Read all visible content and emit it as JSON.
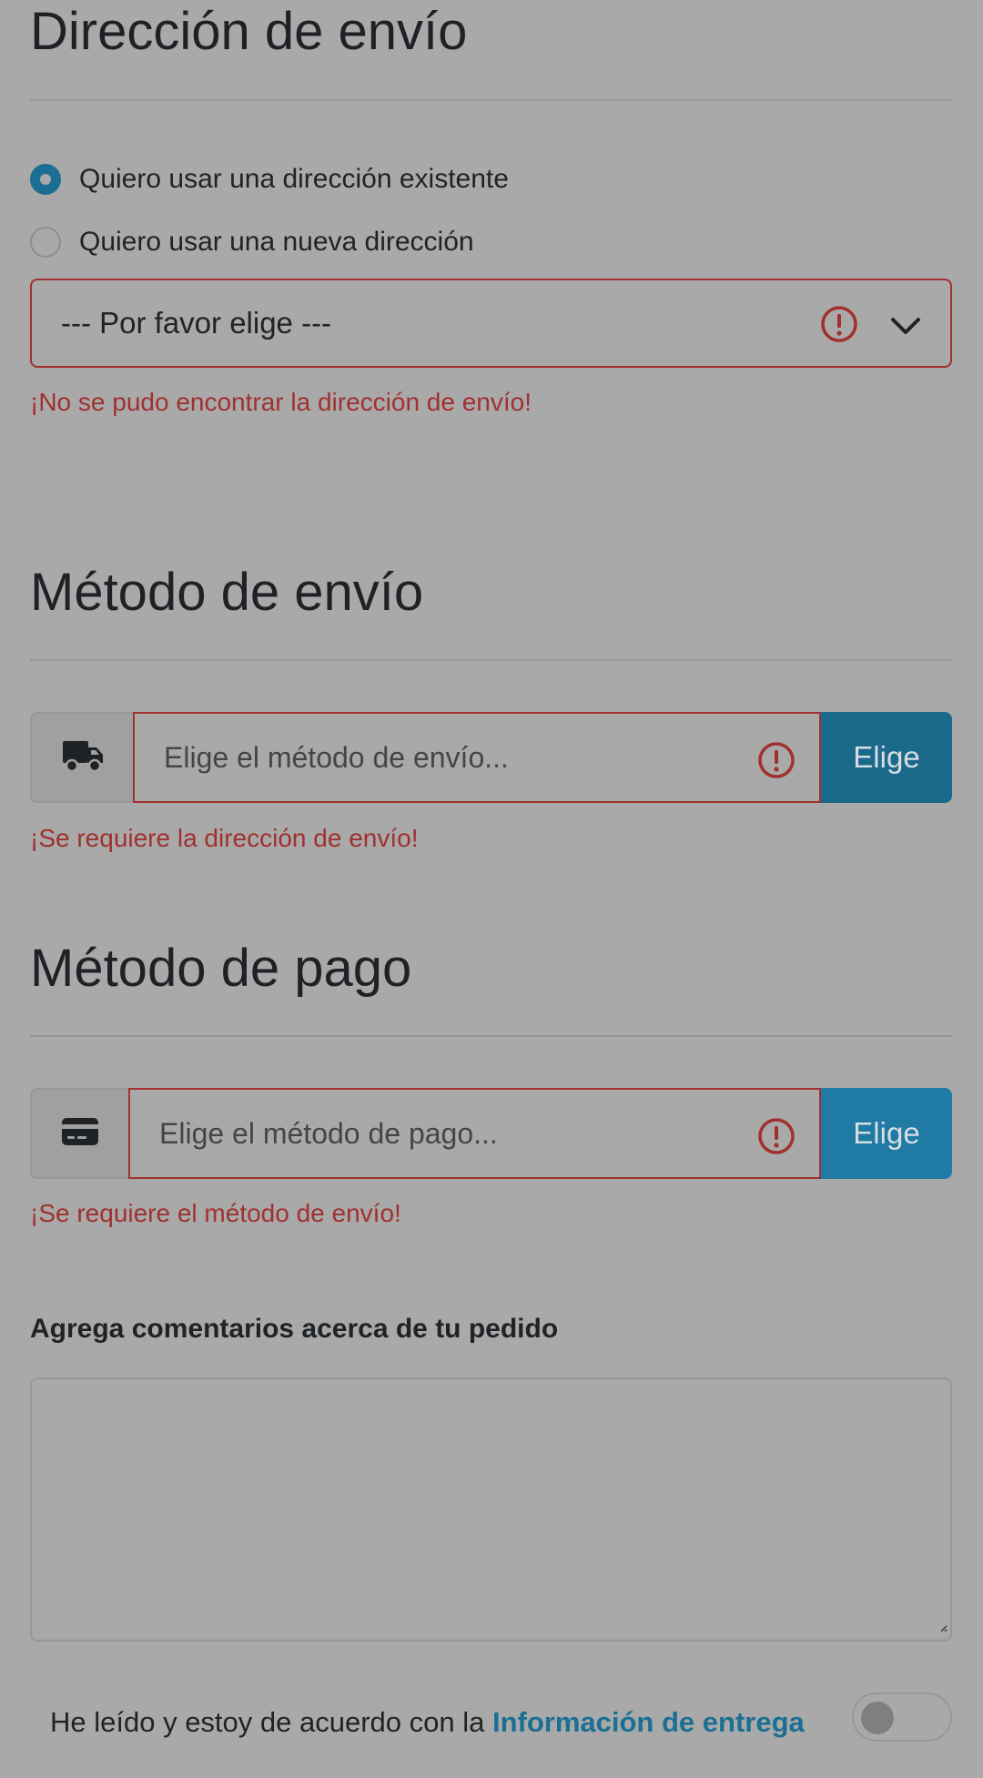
{
  "shipping_address": {
    "title": "Dirección de envío",
    "options": [
      {
        "label": "Quiero usar una dirección existente",
        "checked": true
      },
      {
        "label": "Quiero usar una nueva dirección",
        "checked": false
      }
    ],
    "select_value": "--- Por favor elige ---",
    "error": "¡No se pudo encontrar la dirección de envío!"
  },
  "shipping_method": {
    "title": "Método de envío",
    "icon": "truck-icon",
    "placeholder": "Elige el método de envío...",
    "button": "Elige",
    "error": "¡Se requiere la dirección de envío!"
  },
  "payment_method": {
    "title": "Método de pago",
    "icon": "credit-card-icon",
    "placeholder": "Elige el método de pago...",
    "button": "Elige",
    "error": "¡Se requiere el método de envío!"
  },
  "comments": {
    "label": "Agrega comentarios acerca de tu pedido"
  },
  "agreement": {
    "text": "He leído y estoy de acuerdo con la ",
    "link": "Información de entrega",
    "toggle_on": false
  },
  "colors": {
    "background": "#a9a9a9",
    "error": "#a0312f",
    "accent": "#1b6f93"
  }
}
